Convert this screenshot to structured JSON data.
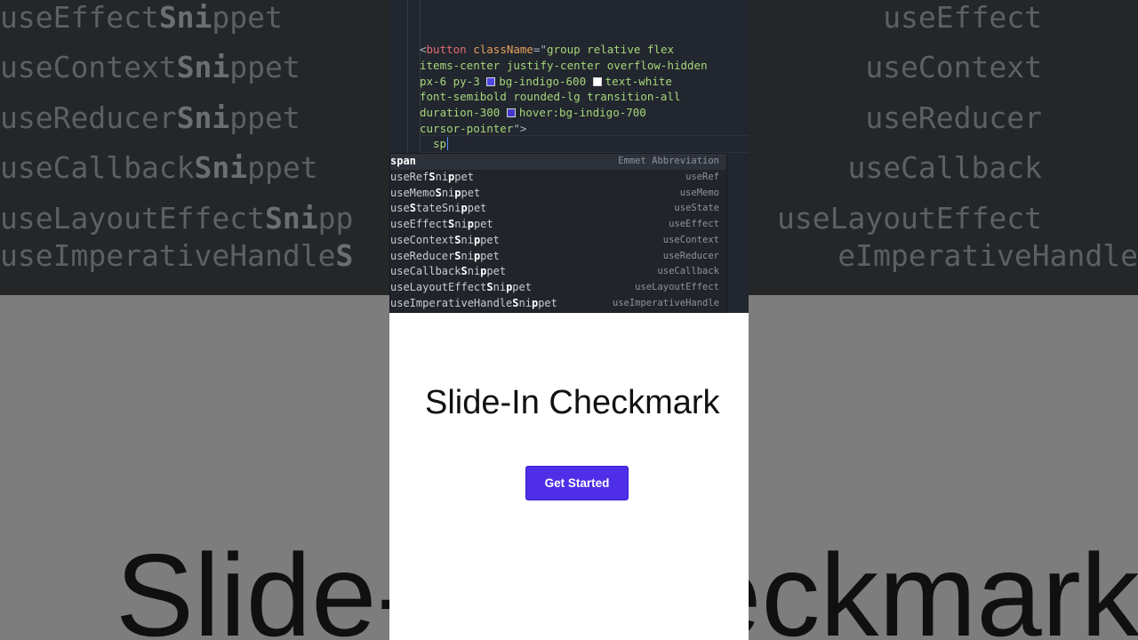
{
  "background": {
    "rows": [
      {
        "left": "useEffect",
        "bold": "Sni",
        "after": "ppet",
        "right": "useEffect"
      },
      {
        "left": "useContext",
        "bold": "Sni",
        "after": "ppet",
        "right": "useContext"
      },
      {
        "left": "useReducer",
        "bold": "Sni",
        "after": "ppet",
        "right": "useReducer"
      },
      {
        "left": "useCallback",
        "bold": "Sni",
        "after": "ppet",
        "right": "useCallback"
      },
      {
        "left": "useLayoutEffect",
        "bold": "Sni",
        "after": "pp",
        "right": "useLayoutEffect"
      },
      {
        "left": "useImperativeHandle",
        "bold": "S",
        "after": "",
        "right": "eImperativeHandle"
      }
    ],
    "title": "Slide-In Checkmark"
  },
  "editor": {
    "code": {
      "tag_open": "<",
      "tag_name": "button",
      "attr_name": "className",
      "eq_quote": "=\"",
      "line1": "group relative flex",
      "line2": "items-center justify-center overflow-hidden",
      "line3a": "px-6 py-3",
      "line3b": "bg-indigo-600",
      "line3c": "text-white",
      "line4": "font-semibold rounded-lg transition-all",
      "line5a": "duration-300",
      "line5b": "hover:bg-indigo-700",
      "line6a": "cursor-pointer",
      "line6b": "\">"
    },
    "typed": "sp",
    "swatch_colors": {
      "indigo600": "#4f46e5",
      "white": "#ffffff",
      "indigo700": "#4338ca"
    }
  },
  "suggestions": [
    {
      "label": "span",
      "bold": "",
      "after": "",
      "detail": "Emmet Abbreviation",
      "selected": true
    },
    {
      "label": "useRef",
      "bold": "S",
      "mid": "ni",
      "bold2": "p",
      "after": "pet",
      "detail": "useRef"
    },
    {
      "label": "useMemo",
      "bold": "S",
      "mid": "ni",
      "bold2": "p",
      "after": "pet",
      "detail": "useMemo"
    },
    {
      "label": "use",
      "bold": "S",
      "mid": "tateSni",
      "bold2": "p",
      "after": "pet",
      "detail": "useState"
    },
    {
      "label": "useEffect",
      "bold": "S",
      "mid": "ni",
      "bold2": "p",
      "after": "pet",
      "detail": "useEffect"
    },
    {
      "label": "useContext",
      "bold": "S",
      "mid": "ni",
      "bold2": "p",
      "after": "pet",
      "detail": "useContext"
    },
    {
      "label": "useReducer",
      "bold": "S",
      "mid": "ni",
      "bold2": "p",
      "after": "pet",
      "detail": "useReducer"
    },
    {
      "label": "useCallback",
      "bold": "S",
      "mid": "ni",
      "bold2": "p",
      "after": "pet",
      "detail": "useCallback"
    },
    {
      "label": "useLayoutEffect",
      "bold": "S",
      "mid": "ni",
      "bold2": "p",
      "after": "pet",
      "detail": "useLayoutEffect"
    },
    {
      "label": "useImperativeHandle",
      "bold": "S",
      "mid": "ni",
      "bold2": "p",
      "after": "pet",
      "detail": "useImperativeHandle"
    }
  ],
  "preview": {
    "title": "Slide-In Checkmark",
    "button_label": "Get Started",
    "button_color": "#4f2ee8"
  }
}
